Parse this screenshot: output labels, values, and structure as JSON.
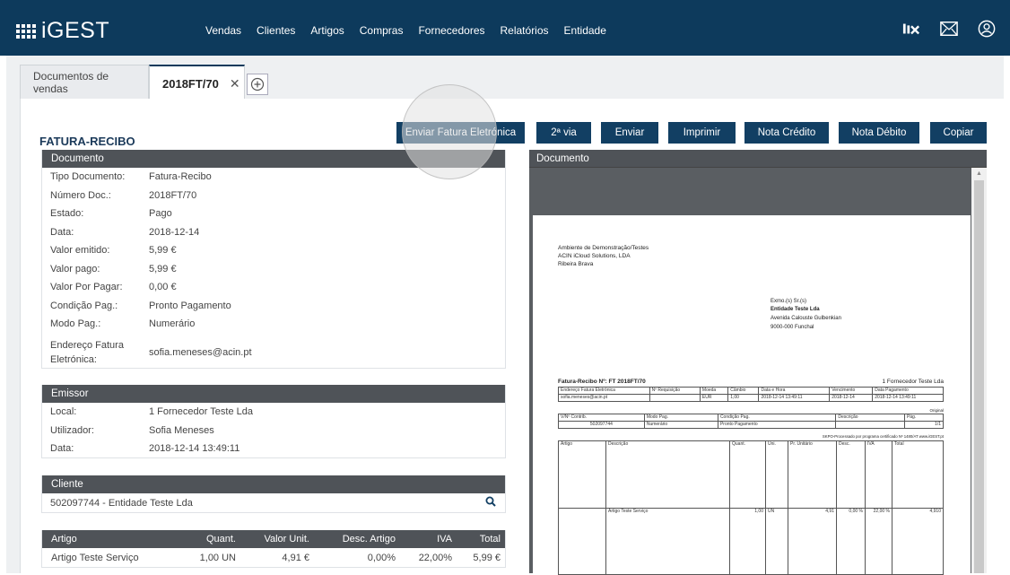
{
  "app": {
    "logo": "iGEST",
    "nav": [
      "Vendas",
      "Clientes",
      "Artigos",
      "Compras",
      "Fornecedores",
      "Relatórios",
      "Entidade"
    ],
    "icons": [
      "ilx-icon",
      "mail-icon",
      "user-icon"
    ]
  },
  "tabs": {
    "t1": "Documentos de vendas",
    "t2": "2018FT/70",
    "close": "✕",
    "add": "+"
  },
  "page": {
    "title": "FATURA-RECIBO",
    "buttons": [
      "Enviar Fatura Eletrónica",
      "2ª via",
      "Enviar",
      "Imprimir",
      "Nota Crédito",
      "Nota Débito",
      "Copiar"
    ]
  },
  "documento": {
    "header": "Documento",
    "rows": [
      {
        "k": "Tipo Documento:",
        "v": "Fatura-Recibo"
      },
      {
        "k": "Número Doc.:",
        "v": "2018FT/70"
      },
      {
        "k": "Estado:",
        "v": "Pago"
      },
      {
        "k": "Data:",
        "v": "2018-12-14"
      },
      {
        "k": "Valor emitido:",
        "v": "5,99 €"
      },
      {
        "k": "Valor pago:",
        "v": "5,99 €"
      },
      {
        "k": "Valor Por Pagar:",
        "v": "0,00 €"
      },
      {
        "k": "Condição Pag.:",
        "v": "Pronto Pagamento"
      },
      {
        "k": "Modo Pag.:",
        "v": "Numerário"
      }
    ],
    "endereco_label_1": "Endereço Fatura",
    "endereco_label_2": "Eletrónica:",
    "endereco_value": "sofia.meneses@acin.pt"
  },
  "emissor": {
    "header": "Emissor",
    "rows": [
      {
        "k": "Local:",
        "v": "1 Fornecedor Teste Lda"
      },
      {
        "k": "Utilizador:",
        "v": "Sofia Meneses"
      },
      {
        "k": "Data:",
        "v": "2018-12-14 13:49:11"
      }
    ]
  },
  "cliente": {
    "header": "Cliente",
    "value": "502097744 - Entidade Teste Lda"
  },
  "artigos": {
    "headers": [
      "Artigo",
      "Quant.",
      "Valor Unit.",
      "Desc. Artigo",
      "IVA",
      "Total"
    ],
    "rows": [
      [
        "Artigo Teste Serviço",
        "1,00 UN",
        "4,91 €",
        "0,00%",
        "22,00%",
        "5,99 €"
      ]
    ]
  },
  "preview": {
    "header": "Documento",
    "emitter_lines": [
      "Ambiente de Demonstração/Testes",
      "ACIN iCloud Solutions, LDA",
      "Ribeira Brava"
    ],
    "recipient_lines": [
      "Exmo.(s) Sr.(s)",
      "Entidade Teste Lda",
      "Avenida Calouste Gulbenkian",
      "9000-000 Funchal"
    ],
    "doc_title": "Fatura-Recibo Nº: FT 2018FT/70",
    "doc_local": "1 Fornecedor Teste Lda",
    "t1_head": [
      "Endereço Fatura Eletrónica",
      "Nº Requisição",
      "Moeda",
      "Câmbio",
      "Data e Hora",
      "Vencimento",
      "Data Pagamento"
    ],
    "t1_row": [
      "sofia.meneses@acin.pt",
      "",
      "EUR",
      "1,00",
      "2018-12-14 13:49:11",
      "2018-12-14",
      "2018-12-14 13:49:11"
    ],
    "original": "Original",
    "t2_head": [
      "V/Nº Contrib.",
      "Modo Pag.",
      "Condição Pag.",
      "Descrição",
      "Pág."
    ],
    "t2_row": [
      "502097744",
      "Numerário",
      "Pronto Pagamento",
      "",
      "1/1"
    ],
    "certif": "SKPO-Processado por programa certificado Nº 1480/AT www.iGEST.pt",
    "t3_head": [
      "Artigo",
      "Descrição",
      "Quant.",
      "Uni.",
      "Pr. Unitário",
      "Desc.",
      "IVA",
      "Total"
    ],
    "t3_row": [
      "",
      "Artigo Teste Serviço",
      "1,00",
      "UN",
      "4,91",
      "0,00 %",
      "22,00 %",
      "4,910"
    ]
  }
}
